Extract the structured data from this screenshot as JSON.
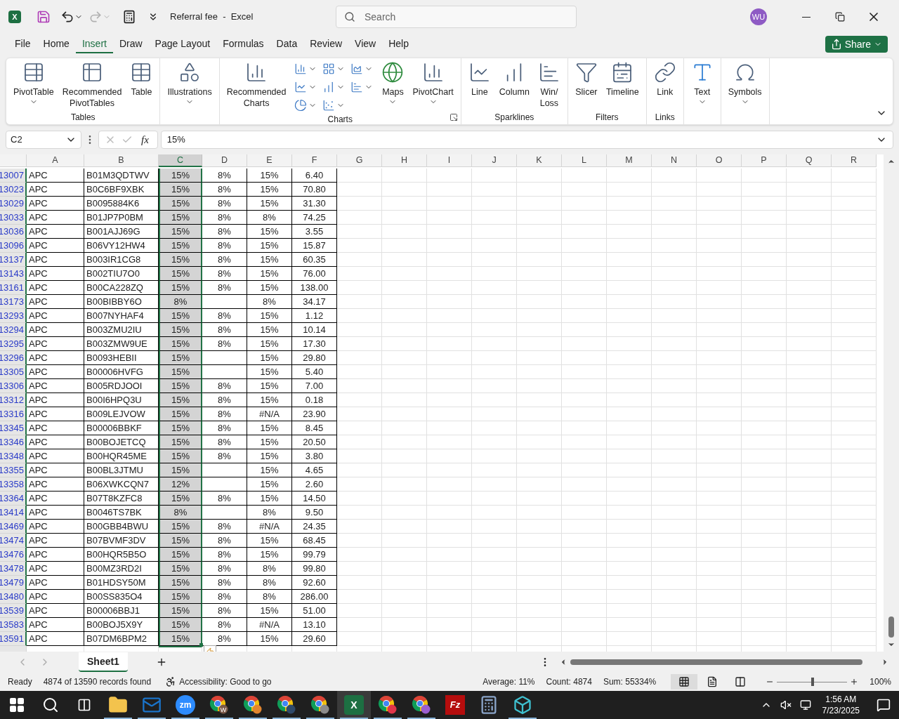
{
  "window": {
    "logo_glyph": "X",
    "title": "Referral fee  -  Excel",
    "search": {
      "placeholder": "Search"
    },
    "avatar": "WU"
  },
  "menu_tabs": [
    {
      "label": "File",
      "selected": false
    },
    {
      "label": "Home",
      "selected": false
    },
    {
      "label": "Insert",
      "selected": true
    },
    {
      "label": "Draw",
      "selected": false
    },
    {
      "label": "Page Layout",
      "selected": false
    },
    {
      "label": "Formulas",
      "selected": false
    },
    {
      "label": "Data",
      "selected": false
    },
    {
      "label": "Review",
      "selected": false
    },
    {
      "label": "View",
      "selected": false
    },
    {
      "label": "Help",
      "selected": false
    }
  ],
  "share_button": "Share",
  "ribbon_groups": [
    {
      "label": "Tables",
      "buttons": [
        {
          "kind": "pivot-table",
          "label": "PivotTable",
          "dropdown": true
        },
        {
          "kind": "recommended-pivot",
          "label": "Recommended\nPivotTables"
        },
        {
          "kind": "table",
          "label": "Table"
        }
      ]
    },
    {
      "buttons": [
        {
          "kind": "illustrations",
          "label": "Illustrations",
          "dropdown": true
        }
      ]
    },
    {
      "label": "Charts",
      "launcher": true,
      "buttons": [
        {
          "kind": "recommended-charts",
          "label": "Recommended\nCharts"
        },
        {
          "kind": "chart-gallery"
        },
        {
          "kind": "maps",
          "label": "Maps",
          "dropdown": true
        },
        {
          "kind": "pivot-chart",
          "label": "PivotChart",
          "dropdown": true
        }
      ]
    },
    {
      "label": "Sparklines",
      "buttons": [
        {
          "kind": "line",
          "label": "Line"
        },
        {
          "kind": "column",
          "label": "Column"
        },
        {
          "kind": "win-loss",
          "label": "Win/\nLoss"
        }
      ]
    },
    {
      "label": "Filters",
      "buttons": [
        {
          "kind": "slicer",
          "label": "Slicer"
        },
        {
          "kind": "timeline",
          "label": "Timeline"
        }
      ]
    },
    {
      "label": "Links",
      "buttons": [
        {
          "kind": "link",
          "label": "Link"
        }
      ]
    },
    {
      "buttons": [
        {
          "kind": "text",
          "label": "Text",
          "dropdown": true
        }
      ]
    },
    {
      "buttons": [
        {
          "kind": "symbols",
          "label": "Symbols",
          "dropdown": true
        }
      ]
    }
  ],
  "formula_bar": {
    "name_box": "C2",
    "function_label": "fx",
    "value": "15%"
  },
  "columns": [
    {
      "label": "A",
      "selected": false
    },
    {
      "label": "B",
      "selected": false
    },
    {
      "label": "C",
      "selected": true
    },
    {
      "label": "D",
      "selected": false
    },
    {
      "label": "E",
      "selected": false
    },
    {
      "label": "F",
      "selected": false
    },
    {
      "label": "G",
      "selected": false
    },
    {
      "label": "H",
      "selected": false
    },
    {
      "label": "I",
      "selected": false
    },
    {
      "label": "J",
      "selected": false
    },
    {
      "label": "K",
      "selected": false
    },
    {
      "label": "L",
      "selected": false
    },
    {
      "label": "M",
      "selected": false
    },
    {
      "label": "N",
      "selected": false
    },
    {
      "label": "O",
      "selected": false
    },
    {
      "label": "P",
      "selected": false
    },
    {
      "label": "Q",
      "selected": false
    },
    {
      "label": "R",
      "selected": false
    }
  ],
  "rows": [
    {
      "num": "13007",
      "cells": [
        "APC",
        "B01M3QDTWV",
        "15%",
        "8%",
        "15%",
        "6.40"
      ]
    },
    {
      "num": "13023",
      "cells": [
        "APC",
        "B0C6BF9XBK",
        "15%",
        "8%",
        "15%",
        "70.80"
      ]
    },
    {
      "num": "13029",
      "cells": [
        "APC",
        "B0095884K6",
        "15%",
        "8%",
        "15%",
        "31.30"
      ]
    },
    {
      "num": "13033",
      "cells": [
        "APC",
        "B01JP7P0BM",
        "15%",
        "8%",
        "8%",
        "74.25"
      ]
    },
    {
      "num": "13036",
      "cells": [
        "APC",
        "B001AJJ69G",
        "15%",
        "8%",
        "15%",
        "3.55"
      ]
    },
    {
      "num": "13096",
      "cells": [
        "APC",
        "B06VY12HW4",
        "15%",
        "8%",
        "15%",
        "15.87"
      ]
    },
    {
      "num": "13137",
      "cells": [
        "APC",
        "B003IR1CG8",
        "15%",
        "8%",
        "15%",
        "60.35"
      ]
    },
    {
      "num": "13143",
      "cells": [
        "APC",
        "B002TIU7O0",
        "15%",
        "8%",
        "15%",
        "76.00"
      ]
    },
    {
      "num": "13161",
      "cells": [
        "APC",
        "B00CA228ZQ",
        "15%",
        "8%",
        "15%",
        "138.00"
      ]
    },
    {
      "num": "13173",
      "cells": [
        "APC",
        "B00BIBBY6O",
        "8%",
        null,
        "8%",
        "34.17"
      ]
    },
    {
      "num": "13293",
      "cells": [
        "APC",
        "B007NYHAF4",
        "15%",
        "8%",
        "15%",
        "1.12"
      ]
    },
    {
      "num": "13294",
      "cells": [
        "APC",
        "B003ZMU2IU",
        "15%",
        "8%",
        "15%",
        "10.14"
      ]
    },
    {
      "num": "13295",
      "cells": [
        "APC",
        "B003ZMW9UE",
        "15%",
        "8%",
        "15%",
        "17.30"
      ]
    },
    {
      "num": "13296",
      "cells": [
        "APC",
        "B0093HEBII",
        "15%",
        null,
        "15%",
        "29.80"
      ]
    },
    {
      "num": "13305",
      "cells": [
        "APC",
        "B00006HVFG",
        "15%",
        null,
        "15%",
        "5.40"
      ]
    },
    {
      "num": "13306",
      "cells": [
        "APC",
        "B005RDJOOI",
        "15%",
        "8%",
        "15%",
        "7.00"
      ]
    },
    {
      "num": "13312",
      "cells": [
        "APC",
        "B00I6HPQ3U",
        "15%",
        "8%",
        "15%",
        "0.18"
      ]
    },
    {
      "num": "13316",
      "cells": [
        "APC",
        "B009LEJVOW",
        "15%",
        "8%",
        "#N/A",
        "23.90"
      ]
    },
    {
      "num": "13345",
      "cells": [
        "APC",
        "B00006BBKF",
        "15%",
        "8%",
        "15%",
        "8.45"
      ]
    },
    {
      "num": "13346",
      "cells": [
        "APC",
        "B00BOJETCQ",
        "15%",
        "8%",
        "15%",
        "20.50"
      ]
    },
    {
      "num": "13348",
      "cells": [
        "APC",
        "B00HQR45ME",
        "15%",
        "8%",
        "15%",
        "3.80"
      ]
    },
    {
      "num": "13355",
      "cells": [
        "APC",
        "B00BL3JTMU",
        "15%",
        null,
        "15%",
        "4.65"
      ]
    },
    {
      "num": "13358",
      "cells": [
        "APC",
        "B06XWKCQN7",
        "12%",
        null,
        "15%",
        "2.60"
      ]
    },
    {
      "num": "13364",
      "cells": [
        "APC",
        "B07T8KZFC8",
        "15%",
        "8%",
        "15%",
        "14.50"
      ]
    },
    {
      "num": "13414",
      "cells": [
        "APC",
        "B0046TS7BK",
        "8%",
        null,
        "8%",
        "9.50"
      ]
    },
    {
      "num": "13469",
      "cells": [
        "APC",
        "B00GBB4BWU",
        "15%",
        "8%",
        "#N/A",
        "24.35"
      ]
    },
    {
      "num": "13474",
      "cells": [
        "APC",
        "B07BVMF3DV",
        "15%",
        "8%",
        "15%",
        "68.45"
      ]
    },
    {
      "num": "13476",
      "cells": [
        "APC",
        "B00HQR5B5O",
        "15%",
        "8%",
        "15%",
        "99.79"
      ]
    },
    {
      "num": "13478",
      "cells": [
        "APC",
        "B00MZ3RD2I",
        "15%",
        "8%",
        "8%",
        "99.80"
      ]
    },
    {
      "num": "13479",
      "cells": [
        "APC",
        "B01HDSY50M",
        "15%",
        "8%",
        "8%",
        "92.60"
      ]
    },
    {
      "num": "13480",
      "cells": [
        "APC",
        "B00SS835O4",
        "15%",
        "8%",
        "8%",
        "286.00"
      ]
    },
    {
      "num": "13539",
      "cells": [
        "APC",
        "B00006BBJ1",
        "15%",
        "8%",
        "15%",
        "51.00"
      ]
    },
    {
      "num": "13583",
      "cells": [
        "APC",
        "B00BOJ5X9Y",
        "15%",
        "8%",
        "#N/A",
        "13.10"
      ]
    },
    {
      "num": "13591",
      "cells": [
        "APC",
        "B07DM6BPM2",
        "15%",
        "8%",
        "15%",
        "29.60"
      ]
    }
  ],
  "sheet_tabs": [
    {
      "label": "Sheet1",
      "selected": true
    }
  ],
  "status_bar": {
    "mode": "Ready",
    "records": "4874 of 13590 records found",
    "accessibility": "Accessibility: Good to go",
    "average": "Average: 11%",
    "count": "Count: 4874",
    "sum": "Sum: 55334%",
    "views": [
      {
        "kind": "normal",
        "selected": true
      },
      {
        "kind": "page-layout",
        "selected": false
      },
      {
        "kind": "page-break",
        "selected": false
      }
    ],
    "zoom": {
      "level": 0.51,
      "reading": "100%"
    }
  },
  "taskbar": {
    "apps": [
      {
        "kind": "start",
        "running": false,
        "selected": false
      },
      {
        "kind": "search",
        "running": false,
        "selected": false
      },
      {
        "kind": "task-view",
        "running": false,
        "selected": false
      },
      {
        "kind": "explorer",
        "running": true,
        "selected": false
      },
      {
        "kind": "outlook",
        "running": true,
        "selected": false
      },
      {
        "kind": "zoom",
        "glyph": "zm",
        "running": true,
        "selected": false
      },
      {
        "kind": "chrome",
        "color": "#7b5a4a",
        "glyph": "W",
        "running": true,
        "selected": false
      },
      {
        "kind": "chrome",
        "color": "#e2862f",
        "running": true,
        "selected": false
      },
      {
        "kind": "chrome",
        "color": "#2f4a6b",
        "running": true,
        "selected": false
      },
      {
        "kind": "chrome",
        "color": "#8c8c8c",
        "running": true,
        "selected": false
      },
      {
        "kind": "excel",
        "glyph": "X",
        "running": true,
        "selected": true
      },
      {
        "kind": "chrome",
        "color": "#e0354a",
        "running": true,
        "selected": false
      },
      {
        "kind": "chrome",
        "color": "#9b5fd0",
        "running": true,
        "selected": false
      },
      {
        "kind": "filezilla",
        "glyph": "Fz",
        "running": false,
        "selected": false
      },
      {
        "kind": "calculator",
        "running": false,
        "selected": false
      },
      {
        "kind": "cube",
        "running": true,
        "selected": false
      }
    ],
    "time": "1:56 AM",
    "date": "7/23/2025"
  }
}
